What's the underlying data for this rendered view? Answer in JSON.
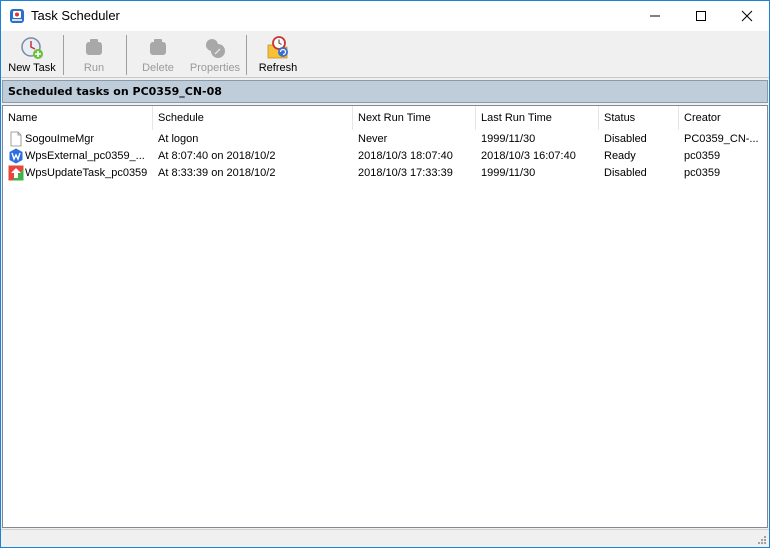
{
  "window": {
    "title": "Task Scheduler",
    "controls": {
      "minimize": "minimize",
      "maximize": "maximize",
      "close": "close"
    }
  },
  "toolbar": {
    "buttons": [
      {
        "label": "New Task",
        "icon": "new-task-icon",
        "enabled": true
      },
      {
        "label": "Run",
        "icon": "run-icon",
        "enabled": false
      },
      {
        "label": "Delete",
        "icon": "delete-icon",
        "enabled": false
      },
      {
        "label": "Properties",
        "icon": "properties-icon",
        "enabled": false
      },
      {
        "label": "Refresh",
        "icon": "refresh-icon",
        "enabled": true
      }
    ]
  },
  "banner": {
    "text": "Scheduled tasks on PC0359_CN-08"
  },
  "list": {
    "columns": [
      "Name",
      "Schedule",
      "Next Run Time",
      "Last Run Time",
      "Status",
      "Creator"
    ],
    "rows": [
      {
        "icon": "blank-document-icon",
        "name": "SogouImeMgr",
        "schedule": "At logon",
        "next_run": "Never",
        "last_run": "1999/11/30",
        "status": "Disabled",
        "creator": "PC0359_CN-..."
      },
      {
        "icon": "wps-w-icon",
        "name": "WpsExternal_pc0359_...",
        "schedule": "At 8:07:40 on 2018/10/2",
        "next_run": "2018/10/3 18:07:40",
        "last_run": "2018/10/3 16:07:40",
        "status": "Ready",
        "creator": "pc0359"
      },
      {
        "icon": "wps-update-icon",
        "name": "WpsUpdateTask_pc0359",
        "schedule": "At 8:33:39 on 2018/10/2",
        "next_run": "2018/10/3 17:33:39",
        "last_run": "1999/11/30",
        "status": "Disabled",
        "creator": "pc0359"
      }
    ]
  },
  "colors": {
    "window_border": "#1883d7",
    "banner_bg": "#bfcddb",
    "disabled_text": "#9a9a9a"
  }
}
